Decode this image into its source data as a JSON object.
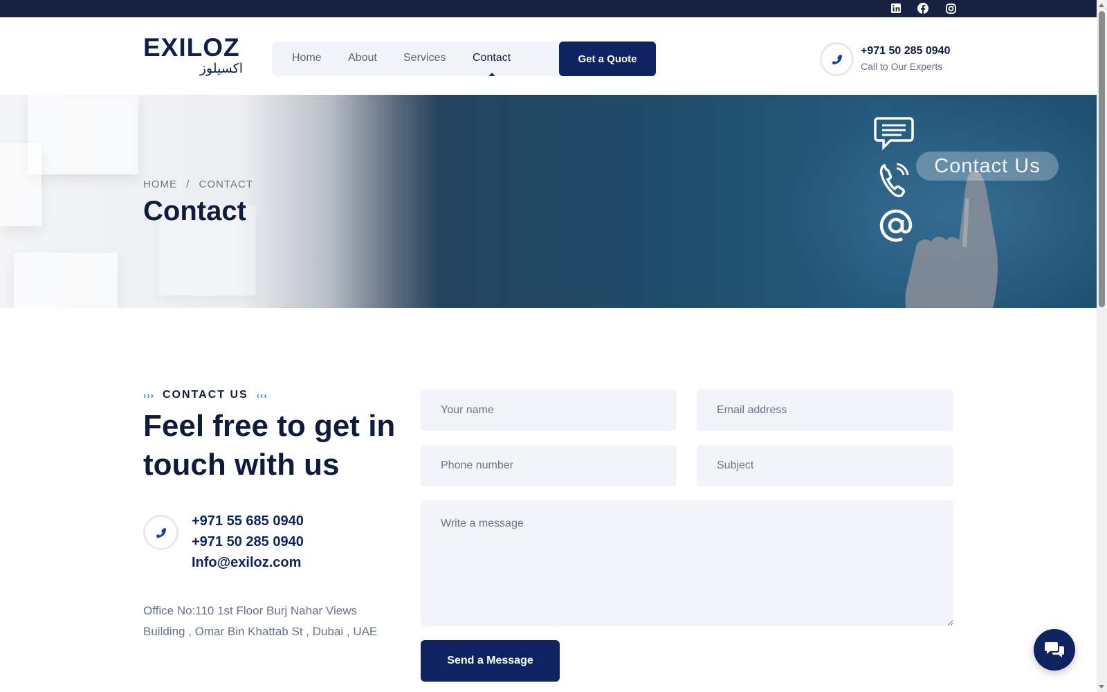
{
  "topbar": {
    "social": [
      "linkedin-icon",
      "facebook-icon",
      "instagram-icon"
    ]
  },
  "header": {
    "logo_latin": "EXILOZ",
    "logo_arabic": "اكسيلوز",
    "nav": [
      {
        "label": "Home",
        "active": false
      },
      {
        "label": "About",
        "active": false
      },
      {
        "label": "Services",
        "active": false
      },
      {
        "label": "Contact",
        "active": true
      }
    ],
    "quote_button": "Get a Quote",
    "phone": "+971 50 285 0940",
    "phone_sub": "Call to Our Experts"
  },
  "hero": {
    "breadcrumb_home": "HOME",
    "breadcrumb_sep": "/",
    "breadcrumb_current": "CONTACT",
    "title": "Contact",
    "image_pill": "Contact Us"
  },
  "contact": {
    "eyebrow_left": "›››",
    "eyebrow": "CONTACT US",
    "eyebrow_right": "‹‹‹",
    "headline": "Feel free to get in touch with us",
    "phone1": "+971 55 685 0940",
    "phone2": "+971 50 285 0940",
    "email": "Info@exiloz.com",
    "address": "Office No:110 1st Floor Burj Nahar Views Building , Omar Bin Khattab St  , Dubai , UAE"
  },
  "form": {
    "name_placeholder": "Your name",
    "email_placeholder": "Email address",
    "phone_placeholder": "Phone number",
    "subject_placeholder": "Subject",
    "message_placeholder": "Write a message",
    "submit": "Send a Message"
  },
  "colors": {
    "navy": "#0e2360",
    "dark_text": "#0e1b3d",
    "muted": "#66718a",
    "field_bg": "#f1f4f8",
    "topbar": "#16223f",
    "accent_blue": "#2d8fd5"
  }
}
